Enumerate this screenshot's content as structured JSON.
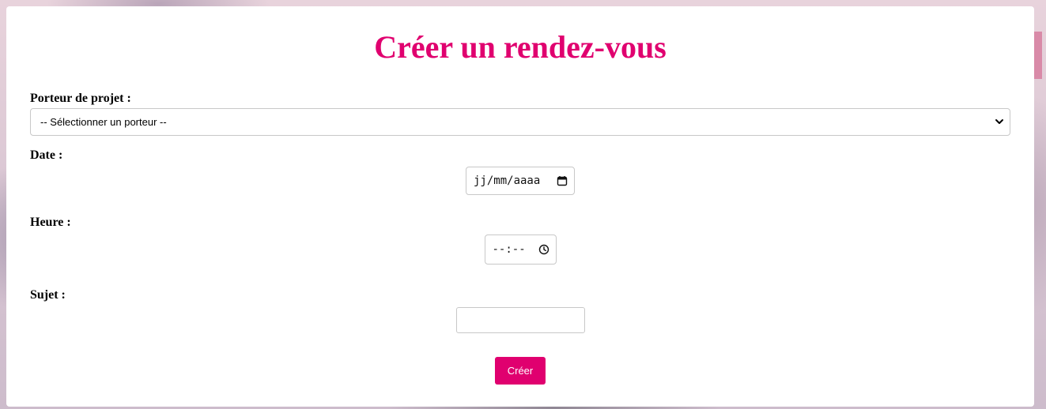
{
  "page": {
    "title": "Créer un rendez-vous"
  },
  "form": {
    "porteur": {
      "label": "Porteur de projet :",
      "selected": "-- Sélectionner un porteur --"
    },
    "date": {
      "label": "Date :",
      "placeholder": "jj/mm/aaaa"
    },
    "heure": {
      "label": "Heure :",
      "placeholder": "--:--"
    },
    "sujet": {
      "label": "Sujet :",
      "value": ""
    },
    "submit_label": "Créer"
  },
  "icons": {
    "select_arrow": "chevron-down-icon",
    "date": "calendar-icon",
    "time": "clock-icon"
  },
  "colors": {
    "accent": "#e0006f",
    "card_background": "#ffffff"
  }
}
